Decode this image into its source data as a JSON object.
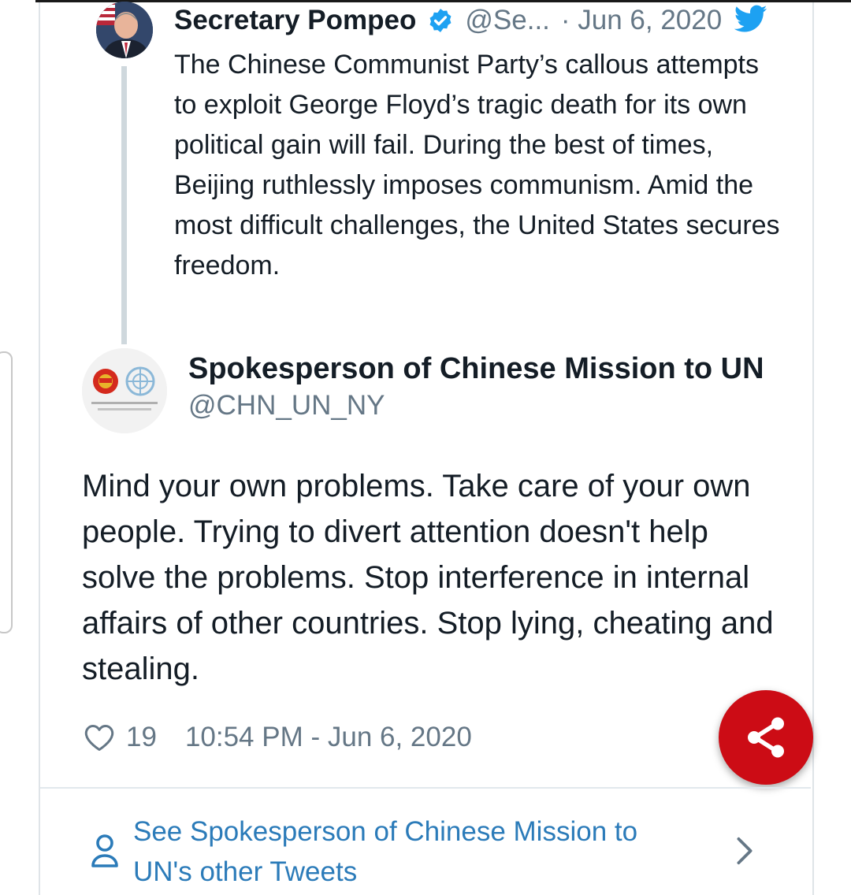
{
  "quoted_tweet": {
    "name": "Secretary Pompeo",
    "handle": "@Se...",
    "date": "· Jun 6, 2020",
    "text": "The Chinese Communist Party’s callous attempts to exploit George Floyd’s tragic death for its own political gain will fail. During the best of times, Beijing ruthlessly imposes communism. Amid the most difficult challenges, the United States secures freedom.",
    "verified": true
  },
  "main_tweet": {
    "name": "Spokesperson of Chinese Mission to UN",
    "handle": "@CHN_UN_NY",
    "text": "Mind your own problems. Take care of your own people. Trying to divert attention doesn't help solve the problems. Stop interference in internal affairs of other countries. Stop lying, cheating and stealing.",
    "likes": "19",
    "timestamp": "10:54 PM - Jun 6, 2020"
  },
  "footer": {
    "other_tweets_label": "See Spokesperson of Chinese Mission to UN's other Tweets"
  },
  "icons": {
    "verified": "verified-badge-icon",
    "twitter": "twitter-bird-icon",
    "like": "heart-icon",
    "share": "share-icon",
    "person": "person-icon",
    "chevron": "chevron-right-icon"
  },
  "colors": {
    "twitter_blue": "#1da1f2",
    "link_blue": "#2b7bb9",
    "share_red": "#cc0c15",
    "secondary_text": "#657786"
  }
}
